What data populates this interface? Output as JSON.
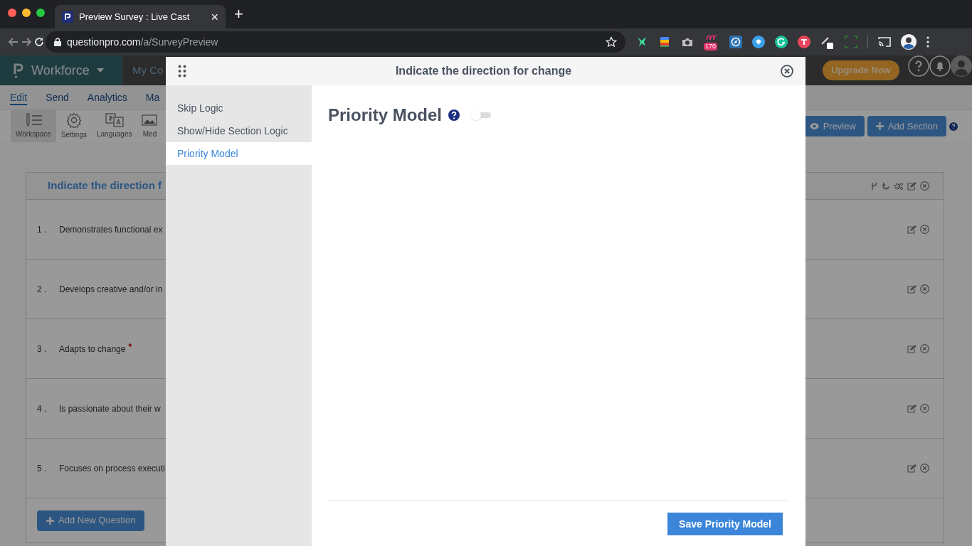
{
  "browser": {
    "tab": {
      "title": "Preview Survey : Live Cast",
      "close": "×"
    },
    "new_tab": "+",
    "url": {
      "host": "questionpro.com",
      "path": "/a/SurveyPreview"
    },
    "extension_badge": "170"
  },
  "app": {
    "product": "Workforce",
    "nav_partial": "My Co",
    "upgrade": "Upgrade Now",
    "tabs": [
      {
        "label": "Edit",
        "selected": true
      },
      {
        "label": "Send",
        "selected": false
      },
      {
        "label": "Analytics",
        "selected": false
      },
      {
        "label": "Ma",
        "selected": false
      }
    ],
    "tools": [
      {
        "label": "Workspace",
        "kind": "workspace",
        "selected": true
      },
      {
        "label": "Settings",
        "kind": "settings",
        "selected": false
      },
      {
        "label": "Languages",
        "kind": "languages",
        "selected": false
      },
      {
        "label": "Med",
        "kind": "media",
        "selected": false
      }
    ],
    "actions": [
      {
        "label": "Preview",
        "kind": "preview"
      },
      {
        "label": "Add Section",
        "kind": "add"
      }
    ],
    "section": {
      "title": "Indicate the direction f",
      "questions": [
        {
          "number": "1 .",
          "text": "Demonstrates functional ex"
        },
        {
          "number": "2 .",
          "text": "Develops creative and/or in"
        },
        {
          "number": "3 .",
          "text": "Adapts to change",
          "required_mark": "*"
        },
        {
          "number": "4 .",
          "text": "Is passionate about their w"
        },
        {
          "number": "5 .",
          "text": "Focuses on process executi"
        }
      ]
    },
    "add_question": "Add New Question"
  },
  "modal": {
    "title": "Indicate the direction for change",
    "menu": [
      {
        "label": "Skip Logic",
        "selected": false
      },
      {
        "label": "Show/Hide Section Logic",
        "selected": false
      },
      {
        "label": "Priority Model",
        "selected": true
      }
    ],
    "heading": "Priority Model",
    "toggle": {
      "on": false
    },
    "save": "Save Priority Model"
  }
}
